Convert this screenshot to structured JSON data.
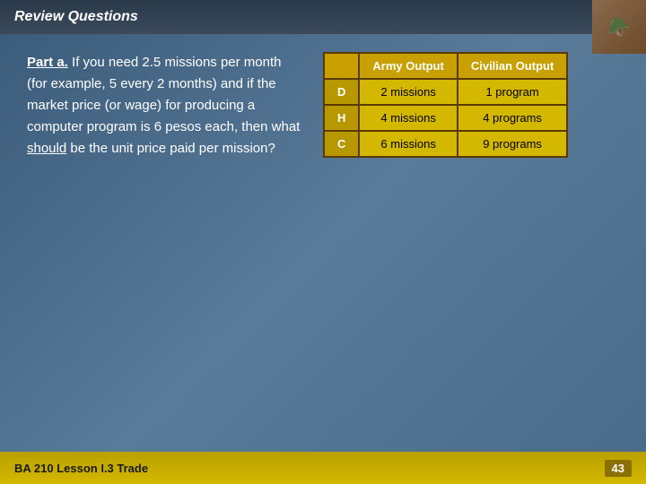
{
  "header": {
    "title": "Review Questions"
  },
  "footer": {
    "label": "BA 210  Lesson I.3  Trade",
    "page": "43"
  },
  "question": {
    "part_label": "Part a.",
    "text_main": "If you need 2.5 missions per month (for example, 5 every 2 months) and if the market price (or wage) for producing a computer program is 6 pesos each, then what ",
    "underline_word": "should",
    "text_end": " be the unit price paid per mission?"
  },
  "table": {
    "col_headers": [
      "",
      "Army Output",
      "Civilian Output"
    ],
    "rows": [
      {
        "key": "D",
        "army": "2 missions",
        "civilian": "1 program"
      },
      {
        "key": "H",
        "army": "4 missions",
        "civilian": "4 programs"
      },
      {
        "key": "C",
        "army": "6 missions",
        "civilian": "9 programs"
      }
    ]
  }
}
